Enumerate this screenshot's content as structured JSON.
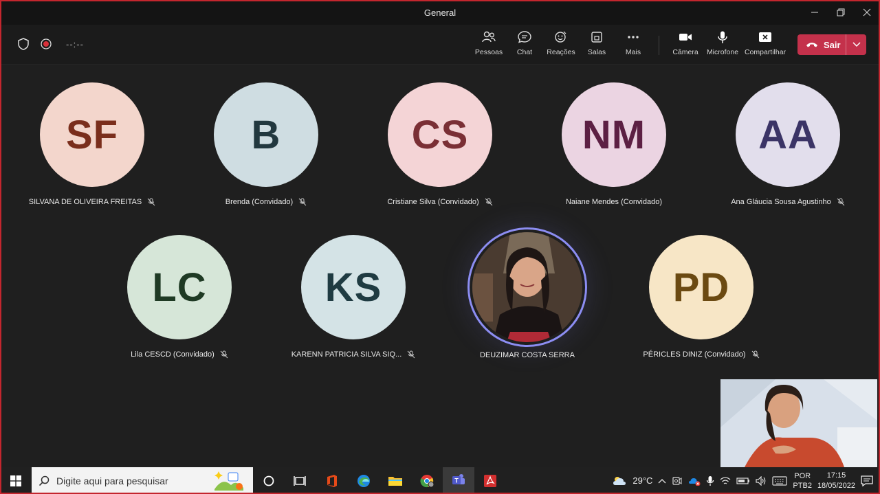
{
  "window": {
    "title": "General"
  },
  "toolbar": {
    "timer": "--:--",
    "buttons": {
      "people": "Pessoas",
      "chat": "Chat",
      "reactions": "Reações",
      "rooms": "Salas",
      "more": "Mais",
      "camera": "Câmera",
      "mic": "Microfone",
      "share": "Compartilhar"
    },
    "leave_label": "Sair"
  },
  "participants": [
    {
      "initials": "SF",
      "name": "SILVANA DE OLIVEIRA FREITAS",
      "bg": "#f3d6cc",
      "fg": "#7a2e1c"
    },
    {
      "initials": "B",
      "name": "Brenda (Convidado)",
      "bg": "#cfdde2",
      "fg": "#22383f"
    },
    {
      "initials": "CS",
      "name": "Cristiane Silva (Convidado)",
      "bg": "#f4d4d6",
      "fg": "#7a2f35"
    },
    {
      "initials": "NM",
      "name": "Naiane Mendes (Convidado)",
      "bg": "#ebd4e2",
      "fg": "#5c1f43"
    },
    {
      "initials": "AA",
      "name": "Ana Gláucia Sousa Agustinho",
      "bg": "#e2deec",
      "fg": "#3b3466"
    },
    {
      "initials": "LC",
      "name": "Lila CESCD (Convidado)",
      "bg": "#d6e6d8",
      "fg": "#1f3a24"
    },
    {
      "initials": "KS",
      "name": "KARENN PATRICIA SILVA SIQ...",
      "bg": "#d4e3e6",
      "fg": "#1f3b42"
    },
    {
      "initials": "",
      "name": "DEUZIMAR COSTA SERRA",
      "bg": "",
      "fg": ""
    },
    {
      "initials": "PD",
      "name": "PÉRICLES DINIZ (Convidado)",
      "bg": "#f7e6c6",
      "fg": "#6b4a12"
    }
  ],
  "taskbar": {
    "search_placeholder": "Digite aqui para pesquisar",
    "weather": "29°C",
    "lang_top": "POR",
    "lang_bottom": "PTB2",
    "time": "17:15",
    "date": "18/05/2022"
  },
  "colors": {
    "accent_leave": "#c4314b",
    "speaking_ring": "#8c8df2",
    "frame_border": "#c4262e"
  }
}
